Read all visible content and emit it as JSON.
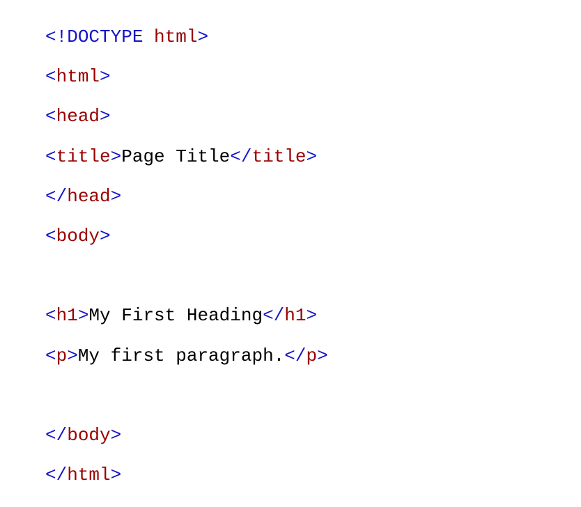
{
  "ang_open": "<",
  "ang_close": ">",
  "ang_open_slash": "</",
  "bang_doctype": "!DOCTYPE",
  "space": " ",
  "kw_html": "html",
  "kw_head": "head",
  "kw_title": "title",
  "kw_body": "body",
  "kw_h1": "h1",
  "kw_p": "p",
  "txt_title": "Page Title",
  "txt_heading": "My First Heading",
  "txt_paragraph": "My first paragraph."
}
